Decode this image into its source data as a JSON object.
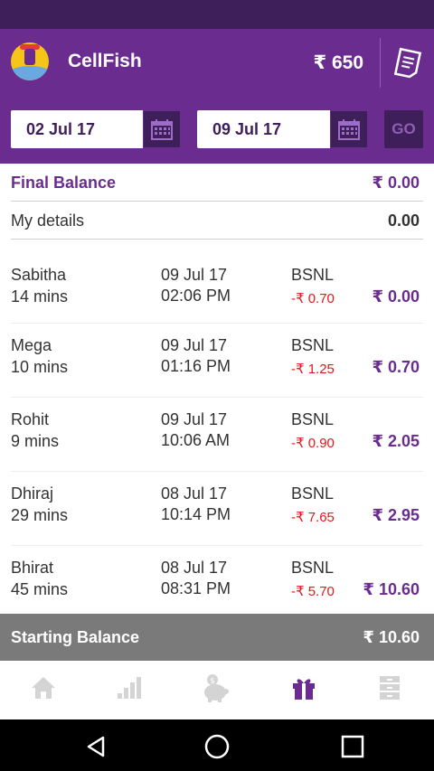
{
  "app": {
    "name": "CellFish",
    "balance": "₹ 650"
  },
  "filters": {
    "from_date": "02 Jul 17",
    "to_date": "09 Jul 17",
    "go_label": "GO"
  },
  "summary": {
    "final_label": "Final Balance",
    "final_value": "₹ 0.00",
    "my_details_label": "My details",
    "my_details_value": "0.00"
  },
  "calls": [
    {
      "name": "Sabitha",
      "mins": "14 mins",
      "date": "09 Jul 17",
      "time": "02:06 PM",
      "operator": "BSNL",
      "charge": "-₹ 0.70",
      "balance": "₹ 0.00"
    },
    {
      "name": "Mega",
      "mins": "10 mins",
      "date": "09 Jul 17",
      "time": "01:16 PM",
      "operator": "BSNL",
      "charge": "-₹ 1.25",
      "balance": "₹ 0.70"
    },
    {
      "name": "Rohit",
      "mins": "9 mins",
      "date": "09 Jul 17",
      "time": "10:06 AM",
      "operator": "BSNL",
      "charge": "-₹ 0.90",
      "balance": "₹ 2.05"
    },
    {
      "name": "Dhiraj",
      "mins": "29 mins",
      "date": "08 Jul 17",
      "time": "10:14 PM",
      "operator": "BSNL",
      "charge": "-₹ 7.65",
      "balance": "₹ 2.95"
    },
    {
      "name": "Bhirat",
      "mins": "45 mins",
      "date": "08 Jul 17",
      "time": "08:31 PM",
      "operator": "BSNL",
      "charge": "-₹ 5.70",
      "balance": "₹ 10.60"
    }
  ],
  "starting": {
    "label": "Starting Balance",
    "value": "₹ 10.60"
  },
  "tabs": [
    {
      "icon": "home-icon"
    },
    {
      "icon": "bar-chart-icon"
    },
    {
      "icon": "piggy-bank-icon"
    },
    {
      "icon": "gift-icon",
      "active": true
    },
    {
      "icon": "history-icon"
    }
  ],
  "colors": {
    "primary": "#6a2d8f",
    "dark": "#3f1f5a",
    "negative": "#e0181b"
  }
}
